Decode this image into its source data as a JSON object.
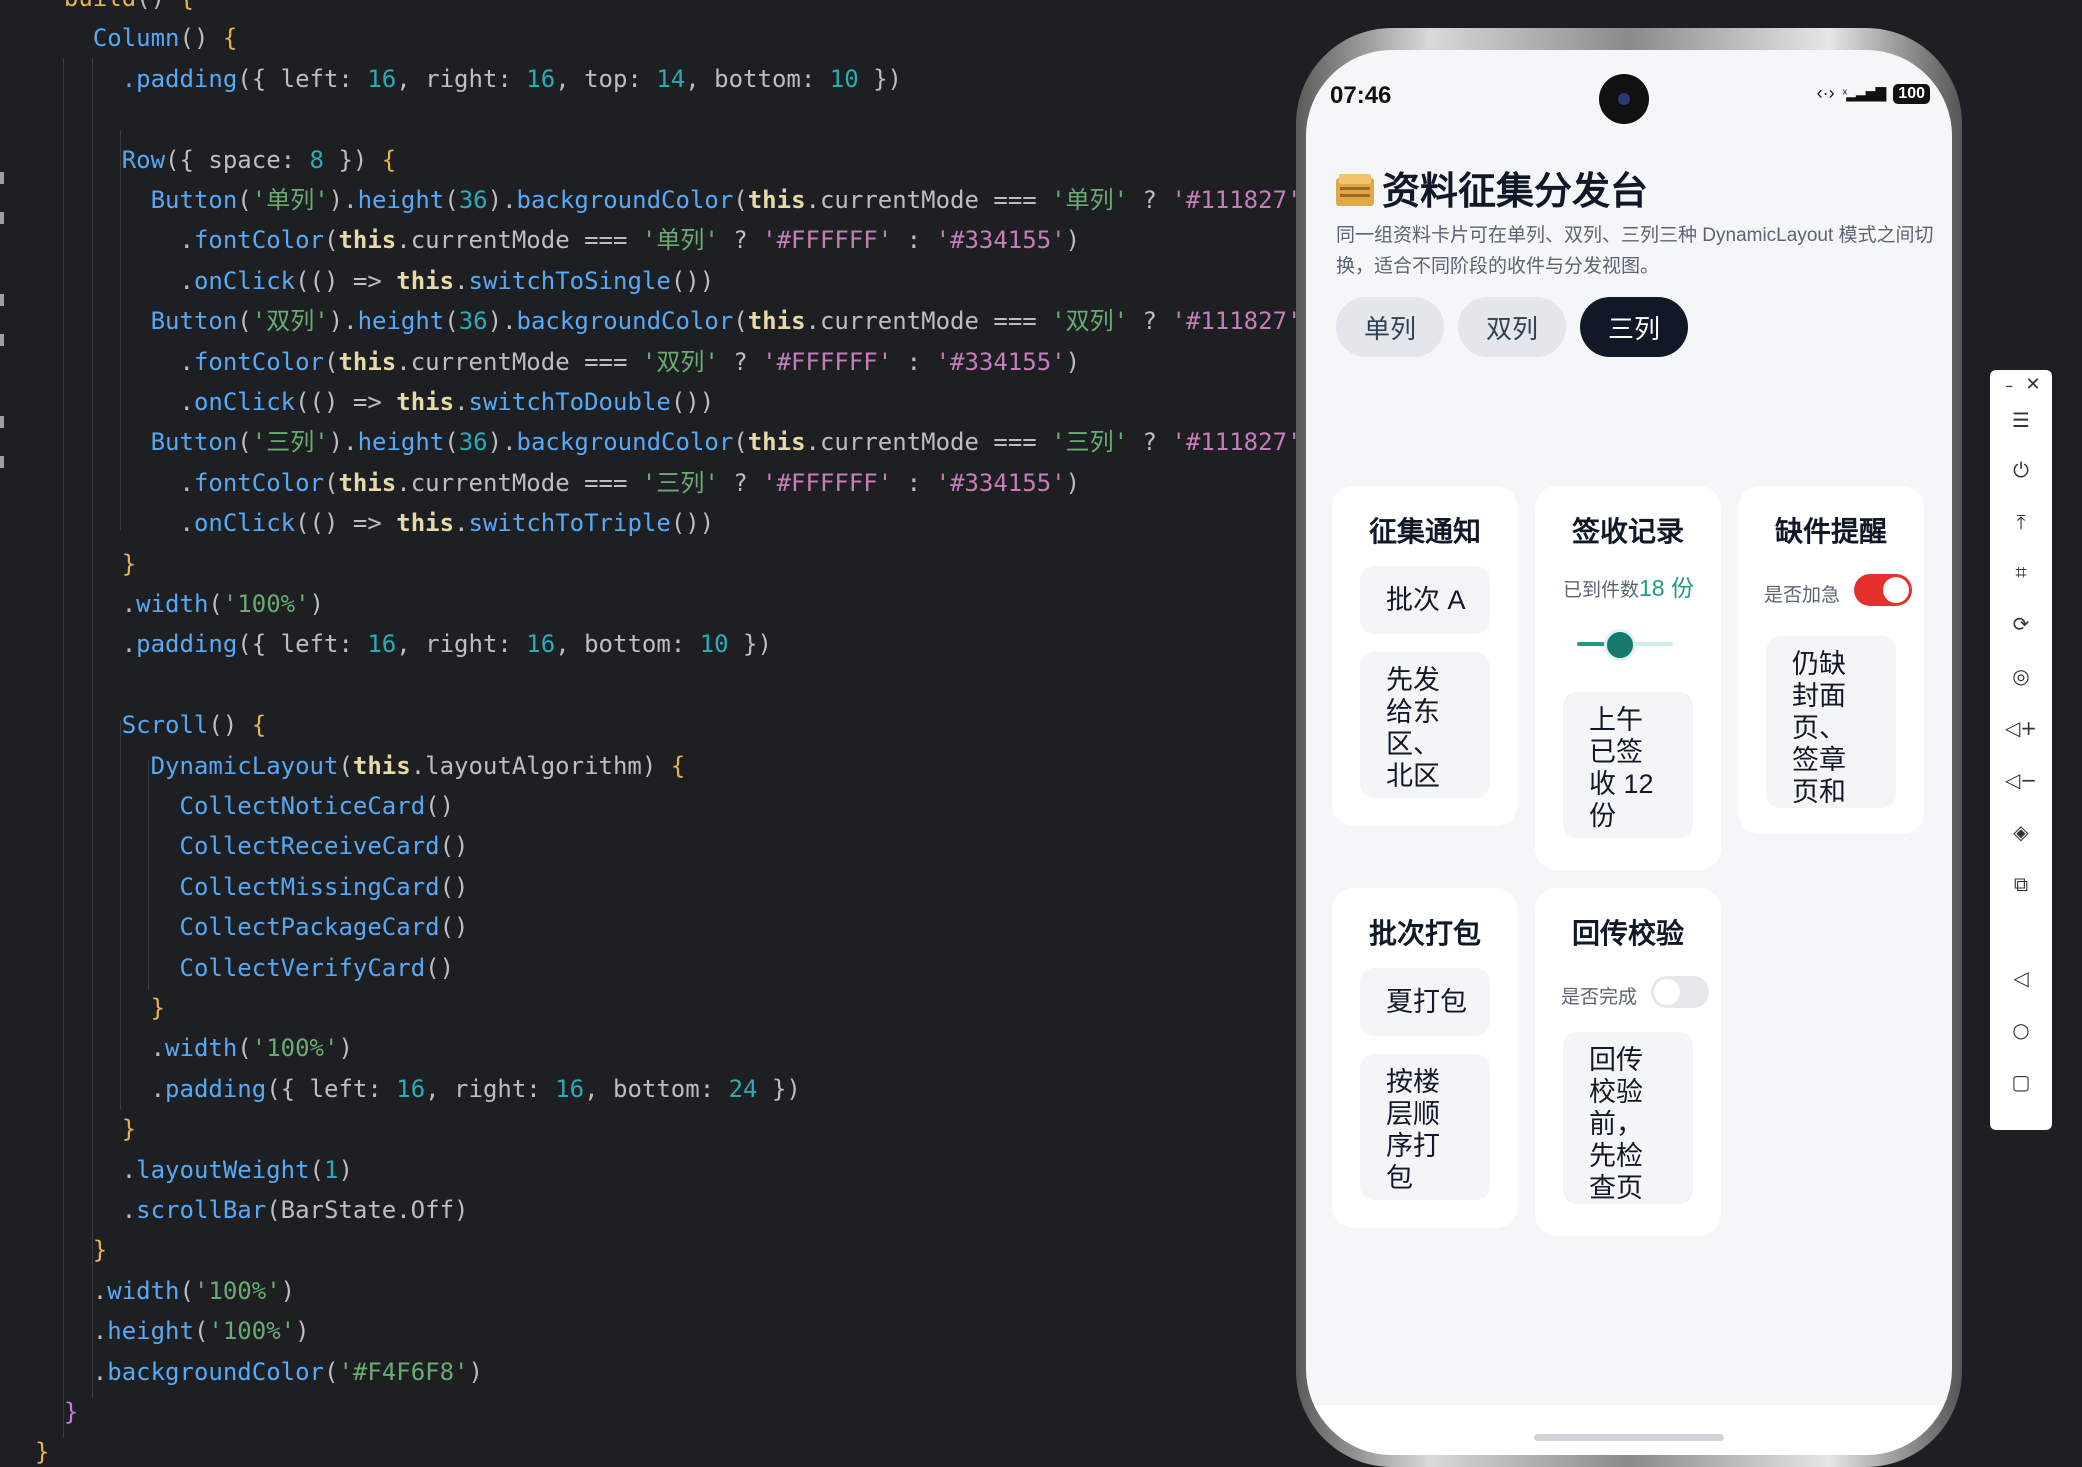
{
  "editor": {
    "lines": [
      {
        "indent": 2,
        "html": "<span class=\"brk\">build</span>() <span class=\"brk\">{</span>"
      },
      {
        "indent": 4,
        "html": "<span class=\"fn\">Column</span>() <span class=\"brk\">{</span>"
      },
      {
        "indent": 6,
        "html": "<span class=\"call\">.padding</span>({ left: <span class=\"num\">16</span>, right: <span class=\"num\">16</span>, top: <span class=\"num\">14</span>, bottom: <span class=\"num\">10</span> })"
      },
      {
        "indent": 0,
        "html": ""
      },
      {
        "indent": 6,
        "html": "<span class=\"fn\">Row</span>({ space: <span class=\"num\">8</span> }) <span class=\"brk\">{</span>"
      },
      {
        "indent": 8,
        "html": "<span class=\"fn\">Button</span>(<span class=\"sstr\">'单列'</span>).<span class=\"call\">height</span>(<span class=\"num\">36</span>).<span class=\"call\">backgroundColor</span>(<span class=\"th\">this</span>.currentMode === <span class=\"sstr\">'单列'</span> ? <span class=\"str\">'#111827'</span> :"
      },
      {
        "indent": 10,
        "html": ".<span class=\"call\">fontColor</span>(<span class=\"th\">this</span>.currentMode === <span class=\"sstr\">'单列'</span> ? <span class=\"str\">'#FFFFFF'</span> : <span class=\"str\">'#334155'</span>)"
      },
      {
        "indent": 10,
        "html": ".<span class=\"call\">onClick</span>(() => <span class=\"th\">this</span>.<span class=\"call\">switchToSingle</span>())"
      },
      {
        "indent": 8,
        "html": "<span class=\"fn\">Button</span>(<span class=\"sstr\">'双列'</span>).<span class=\"call\">height</span>(<span class=\"num\">36</span>).<span class=\"call\">backgroundColor</span>(<span class=\"th\">this</span>.currentMode === <span class=\"sstr\">'双列'</span> ? <span class=\"str\">'#111827'</span> :"
      },
      {
        "indent": 10,
        "html": ".<span class=\"call\">fontColor</span>(<span class=\"th\">this</span>.currentMode === <span class=\"sstr\">'双列'</span> ? <span class=\"str\">'#FFFFFF'</span> : <span class=\"str\">'#334155'</span>)"
      },
      {
        "indent": 10,
        "html": ".<span class=\"call\">onClick</span>(() => <span class=\"th\">this</span>.<span class=\"call\">switchToDouble</span>())"
      },
      {
        "indent": 8,
        "html": "<span class=\"fn\">Button</span>(<span class=\"sstr\">'三列'</span>).<span class=\"call\">height</span>(<span class=\"num\">36</span>).<span class=\"call\">backgroundColor</span>(<span class=\"th\">this</span>.currentMode === <span class=\"sstr\">'三列'</span> ? <span class=\"str\">'#111827'</span> :"
      },
      {
        "indent": 10,
        "html": ".<span class=\"call\">fontColor</span>(<span class=\"th\">this</span>.currentMode === <span class=\"sstr\">'三列'</span> ? <span class=\"str\">'#FFFFFF'</span> : <span class=\"str\">'#334155'</span>)"
      },
      {
        "indent": 10,
        "html": ".<span class=\"call\">onClick</span>(() => <span class=\"th\">this</span>.<span class=\"call\">switchToTriple</span>())"
      },
      {
        "indent": 6,
        "html": "<span class=\"brk\">}</span>"
      },
      {
        "indent": 6,
        "html": ".<span class=\"call\">width</span>(<span class=\"sstr\">'100%'</span>)"
      },
      {
        "indent": 6,
        "html": ".<span class=\"call\">padding</span>({ left: <span class=\"num\">16</span>, right: <span class=\"num\">16</span>, bottom: <span class=\"num\">10</span> })"
      },
      {
        "indent": 0,
        "html": ""
      },
      {
        "indent": 6,
        "html": "<span class=\"fn\">Scroll</span>() <span class=\"brk\">{</span>"
      },
      {
        "indent": 8,
        "html": "<span class=\"fn\">DynamicLayout</span>(<span class=\"th\">this</span>.layoutAlgorithm) <span class=\"brk\">{</span>"
      },
      {
        "indent": 10,
        "html": "<span class=\"fn\">CollectNoticeCard</span>()"
      },
      {
        "indent": 10,
        "html": "<span class=\"fn\">CollectReceiveCard</span>()"
      },
      {
        "indent": 10,
        "html": "<span class=\"fn\">CollectMissingCard</span>()"
      },
      {
        "indent": 10,
        "html": "<span class=\"fn\">CollectPackageCard</span>()"
      },
      {
        "indent": 10,
        "html": "<span class=\"fn\">CollectVerifyCard</span>()"
      },
      {
        "indent": 8,
        "html": "<span class=\"brk\">}</span>"
      },
      {
        "indent": 8,
        "html": ".<span class=\"call\">width</span>(<span class=\"sstr\">'100%'</span>)"
      },
      {
        "indent": 8,
        "html": ".<span class=\"call\">padding</span>({ left: <span class=\"num\">16</span>, right: <span class=\"num\">16</span>, bottom: <span class=\"num\">24</span> })"
      },
      {
        "indent": 6,
        "html": "<span class=\"brk\">}</span>"
      },
      {
        "indent": 6,
        "html": ".<span class=\"call\">layoutWeight</span>(<span class=\"num\">1</span>)"
      },
      {
        "indent": 6,
        "html": ".<span class=\"call\">scrollBar</span>(BarState.Off)"
      },
      {
        "indent": 4,
        "html": "<span class=\"brk\">}</span>"
      },
      {
        "indent": 4,
        "html": ".<span class=\"call\">width</span>(<span class=\"sstr\">'100%'</span>)"
      },
      {
        "indent": 4,
        "html": ".<span class=\"call\">height</span>(<span class=\"sstr\">'100%'</span>)"
      },
      {
        "indent": 4,
        "html": ".<span class=\"call\">backgroundColor</span>(<span class=\"sstr\">'#F4F6F8'</span>)"
      },
      {
        "indent": 2,
        "html": "<span class=\"brk2\">}</span>"
      },
      {
        "indent": 0,
        "html": "<span class=\"brk\">}</span>"
      }
    ]
  },
  "status": {
    "time": "07:46",
    "battery": "100"
  },
  "app": {
    "icon": "folder-icon",
    "title": "资料征集分发台",
    "description": "同一组资料卡片可在单列、双列、三列三种 DynamicLayout 模式之间切换，适合不同阶段的收件与分发视图。",
    "modes": [
      {
        "label": "单列",
        "active": false
      },
      {
        "label": "双列",
        "active": false
      },
      {
        "label": "三列",
        "active": true
      }
    ]
  },
  "cards": {
    "notice": {
      "title": "征集通知",
      "chip": "批次 A",
      "body": "先发给东区、北区"
    },
    "receive": {
      "title": "签收记录",
      "count_label": "已到件数",
      "count_value": "18 份",
      "slider_fraction": 0.45,
      "body": "上午已签收 12 份"
    },
    "missing": {
      "title": "缺件提醒",
      "toggle_label": "是否加急",
      "toggle_on": true,
      "body": "仍缺封面页、签章页和"
    },
    "package": {
      "title": "批次打包",
      "chip": "夏打包",
      "body": "按楼层顺序打包"
    },
    "verify": {
      "title": "回传校验",
      "toggle_label": "是否完成",
      "toggle_on": false,
      "body": "回传校验前，先检查页"
    }
  },
  "colors": {
    "accent_teal": "#1F9988",
    "toggle_on": "#E5302E",
    "toggle_off": "#E5E7EB",
    "active_mode": "#111827"
  },
  "toolbar_icons": [
    "minimize-icon",
    "close-icon",
    "menu-icon",
    "power-icon",
    "pin-top-icon",
    "crop-icon",
    "rotate-icon",
    "location-icon",
    "volume-up-icon",
    "volume-down-icon",
    "shake-icon",
    "multi-screen-icon",
    "back-icon",
    "home-icon",
    "recents-icon"
  ]
}
